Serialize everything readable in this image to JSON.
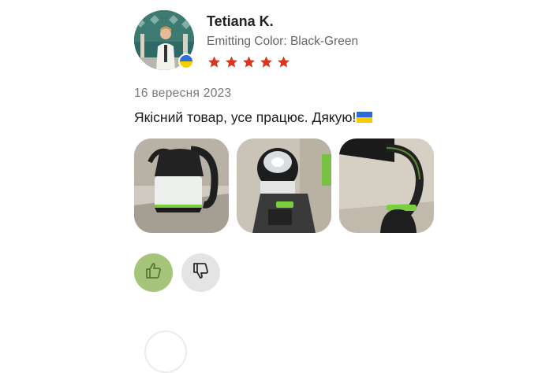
{
  "reviewer": {
    "name": "Tetiana K.",
    "variant": "Emitting Color: Black-Green",
    "country_flag": "ukraine-flag-icon",
    "rating": 5,
    "rating_max": 5,
    "star_color": "#d9351f"
  },
  "review": {
    "date": "16 вересня 2023",
    "text": "Якісний товар, усе працює. Дякую!",
    "trailing_emoji": "ukraine-flag-icon"
  },
  "photos": [
    {
      "name": "review-photo-1",
      "subject": "lantern-with-handle"
    },
    {
      "name": "review-photo-2",
      "subject": "flashlight-head"
    },
    {
      "name": "review-photo-3",
      "subject": "desk-lamp-mode"
    }
  ],
  "votes": {
    "helpful_icon": "thumbs-up-icon",
    "not_helpful_icon": "thumbs-down-icon",
    "helpful_color": "#a6c57b",
    "not_helpful_color": "#e4e4e4"
  }
}
